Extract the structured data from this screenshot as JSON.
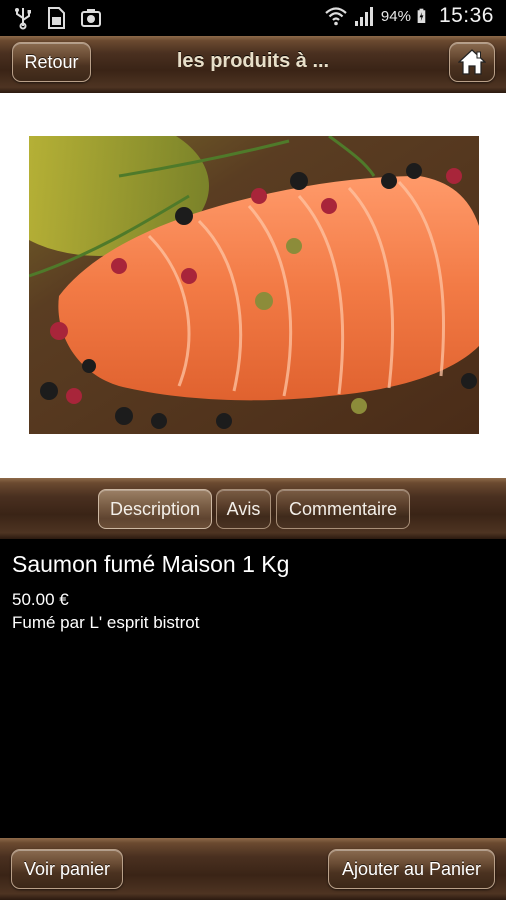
{
  "status_bar": {
    "icons": [
      "usb-icon",
      "sim-icon",
      "screenshot-icon",
      "wifi-icon",
      "signal-icon",
      "battery-charging-icon"
    ],
    "battery": "94%",
    "time": "15:36"
  },
  "header": {
    "back_label": "Retour",
    "title": "les produits à ...",
    "home_icon": "home-icon"
  },
  "product_image": {
    "icon": "salmon-photo"
  },
  "tabs": [
    {
      "label": "Description",
      "active": true
    },
    {
      "label": "Avis",
      "active": false
    },
    {
      "label": "Commentaire",
      "active": false
    }
  ],
  "product": {
    "name": "Saumon fumé Maison 1 Kg",
    "price": "50.00 €",
    "description": "Fumé par L' esprit bistrot"
  },
  "footer": {
    "cart_label": "Voir panier",
    "add_label": "Ajouter au Panier"
  },
  "colors": {
    "bar_brown": "#3a2416",
    "accent_text": "#e8dfc9",
    "background": "#000000"
  }
}
